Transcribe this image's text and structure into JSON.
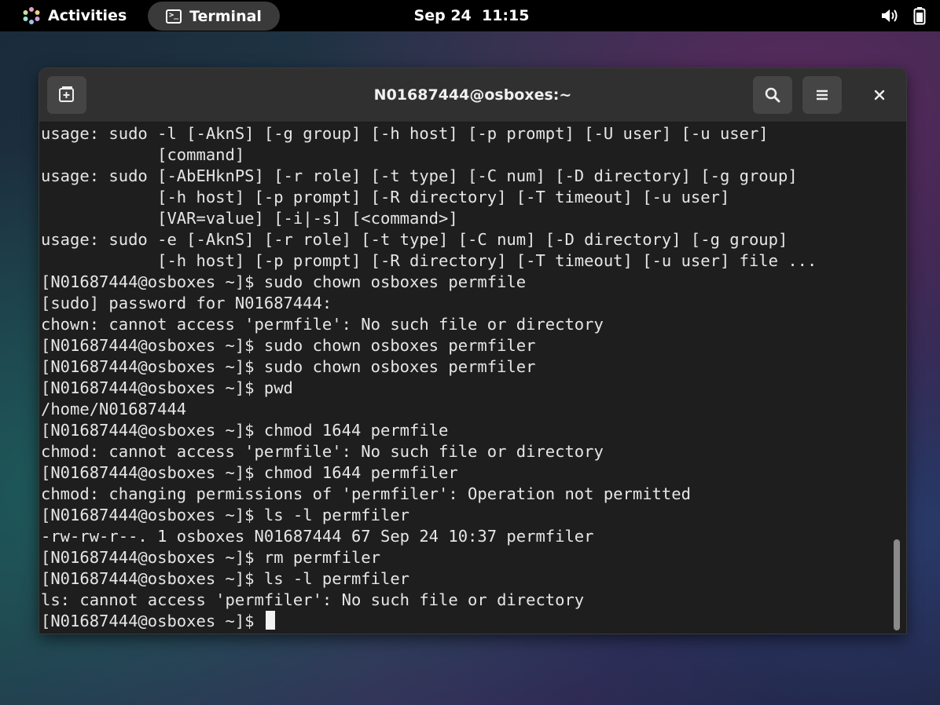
{
  "topbar": {
    "activities_label": "Activities",
    "task_label": "Terminal",
    "clock": "Sep 24  11:15",
    "icons": [
      "gnome-activities-icon",
      "terminal-app-icon",
      "volume-icon",
      "battery-icon"
    ]
  },
  "window": {
    "title": "N01687444@osboxes:~",
    "buttons": {
      "new_tab": "new-tab-icon",
      "search": "search-icon",
      "menu": "hamburger-menu-icon",
      "close": "close-icon"
    }
  },
  "terminal": {
    "lines": [
      "usage: sudo -l [-AknS] [-g group] [-h host] [-p prompt] [-U user] [-u user]",
      "            [command]",
      "usage: sudo [-AbEHknPS] [-r role] [-t type] [-C num] [-D directory] [-g group]",
      "            [-h host] [-p prompt] [-R directory] [-T timeout] [-u user]",
      "            [VAR=value] [-i|-s] [<command>]",
      "usage: sudo -e [-AknS] [-r role] [-t type] [-C num] [-D directory] [-g group]",
      "            [-h host] [-p prompt] [-R directory] [-T timeout] [-u user] file ...",
      "[N01687444@osboxes ~]$ sudo chown osboxes permfile",
      "[sudo] password for N01687444:",
      "chown: cannot access 'permfile': No such file or directory",
      "[N01687444@osboxes ~]$ sudo chown osboxes permfiler",
      "[N01687444@osboxes ~]$ sudo chown osboxes permfiler",
      "[N01687444@osboxes ~]$ pwd",
      "/home/N01687444",
      "[N01687444@osboxes ~]$ chmod 1644 permfile",
      "chmod: cannot access 'permfile': No such file or directory",
      "[N01687444@osboxes ~]$ chmod 1644 permfiler",
      "chmod: changing permissions of 'permfiler': Operation not permitted",
      "[N01687444@osboxes ~]$ ls -l permfiler",
      "-rw-rw-r--. 1 osboxes N01687444 67 Sep 24 10:37 permfiler",
      "[N01687444@osboxes ~]$ rm permfiler",
      "[N01687444@osboxes ~]$ ls -l permfiler",
      "ls: cannot access 'permfiler': No such file or directory"
    ],
    "prompt": "[N01687444@osboxes ~]$ "
  }
}
